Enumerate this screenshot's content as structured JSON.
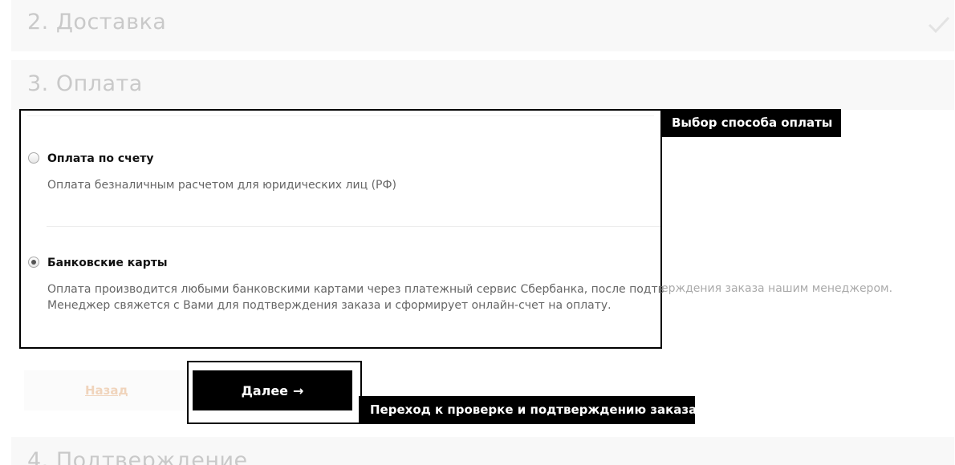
{
  "steps": {
    "delivery": {
      "title": "2. Доставка",
      "completed_icon": "check-icon"
    },
    "payment": {
      "title": "3. Оплата"
    },
    "confirm": {
      "title": "4. Подтверждение"
    }
  },
  "payment_options": [
    {
      "label": "Оплата по счету",
      "description": "Оплата безналичным расчетом для юридических лиц (РФ)",
      "selected": false
    },
    {
      "label": "Банковские карты",
      "description_line1_inside": "Оплата производится любыми банковскими картами через платежный сервис Сбербанка, после подтв",
      "description_line1_overflow": "ерждения заказа нашим менеджером.",
      "description_line2": "Менеджер свяжется с Вами для подтверждения заказа и сформирует онлайн-счет на оплату.",
      "selected": true
    }
  ],
  "callouts": {
    "payment_choice": "Выбор способа оплаты",
    "next_step": "Переход к проверке и подтверждению заказа"
  },
  "nav": {
    "back_label": "Назад",
    "next_label": "Далее",
    "next_arrow": "→"
  },
  "colors": {
    "step_title": "#c9c9c9",
    "back_link": "#f0d4bc",
    "button": "#000000"
  }
}
